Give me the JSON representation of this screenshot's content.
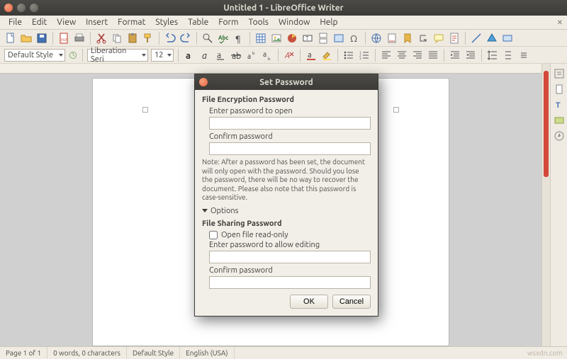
{
  "window": {
    "title": "Untitled 1 - LibreOffice Writer"
  },
  "menubar": {
    "items": [
      "File",
      "Edit",
      "View",
      "Insert",
      "Format",
      "Styles",
      "Table",
      "Form",
      "Tools",
      "Window",
      "Help"
    ]
  },
  "toolbar_main": {
    "icons": [
      "new-doc",
      "open",
      "save",
      "export-pdf",
      "print",
      "",
      "cut",
      "copy",
      "paste",
      "clone-fmt",
      "",
      "undo",
      "redo",
      "",
      "find",
      "spellcheck",
      "formatting-marks",
      "",
      "table",
      "image",
      "chart",
      "text-box",
      "page-break",
      "special-char",
      "",
      "hyperlink",
      "footnote",
      "bookmark",
      "cross-ref",
      "comment",
      "track-changes",
      "",
      "line",
      "basic-shapes",
      "draw-functions"
    ]
  },
  "toolbar_format": {
    "para_style": "Default Style",
    "font_name": "Liberation Seri",
    "font_size": "12"
  },
  "statusbar": {
    "page": "Page 1 of 1",
    "words": "0 words, 0 characters",
    "style": "Default Style",
    "lang": "English (USA)"
  },
  "watermark": "wsxdn.com",
  "dialog": {
    "title": "Set Password",
    "section1": "File Encryption Password",
    "enter_pw": "Enter password to open",
    "confirm_pw": "Confirm password",
    "note": "Note: After a password has been set, the document will only open with the password. Should you lose the password, there will be no way to recover the document. Please also note that this password is case-sensitive.",
    "options": "Options",
    "section2": "File Sharing Password",
    "readonly": "Open file read-only",
    "enter_pw2": "Enter password to allow editing",
    "confirm_pw2": "Confirm password",
    "ok": "OK",
    "cancel": "Cancel"
  }
}
